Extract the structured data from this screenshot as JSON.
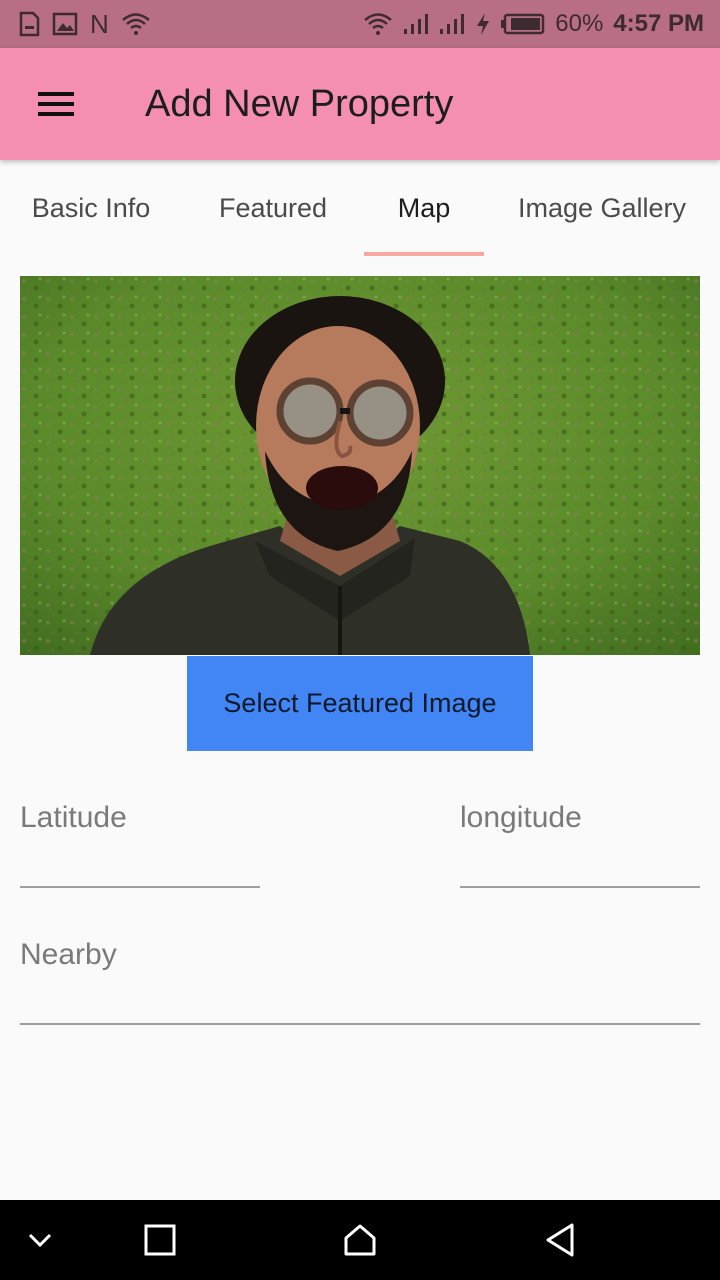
{
  "status_bar": {
    "battery_percent": "60%",
    "time": "4:57 PM",
    "notification_letter": "N",
    "icons": [
      "sim-card-icon",
      "image-icon",
      "n-icon",
      "wifi-question-icon",
      "wifi-icon",
      "signal-icon",
      "signal-icon-2",
      "charging-icon",
      "battery-icon"
    ]
  },
  "app_bar": {
    "title": "Add New Property",
    "menu_icon": "hamburger-menu-icon"
  },
  "tabs": [
    {
      "label": "Basic Info",
      "active": false
    },
    {
      "label": "Featured",
      "active": false
    },
    {
      "label": "Map",
      "active": true
    },
    {
      "label": "Image Gallery",
      "active": false
    }
  ],
  "featured_image": {
    "description_icon": "featured-photo"
  },
  "buttons": {
    "select_featured_image": "Select Featured Image"
  },
  "form": {
    "latitude": {
      "label": "Latitude",
      "value": ""
    },
    "longitude": {
      "label": "longitude",
      "value": ""
    },
    "nearby": {
      "label": "Nearby",
      "value": ""
    }
  },
  "nav_bar": {
    "icons": [
      "collapse-icon",
      "recents-icon",
      "home-icon",
      "back-icon"
    ]
  },
  "colors": {
    "status_bar": "#b86f86",
    "app_bar": "#f48fb1",
    "tab_indicator": "#f7a8a0",
    "button": "#4285f4",
    "background": "#fafafa"
  }
}
